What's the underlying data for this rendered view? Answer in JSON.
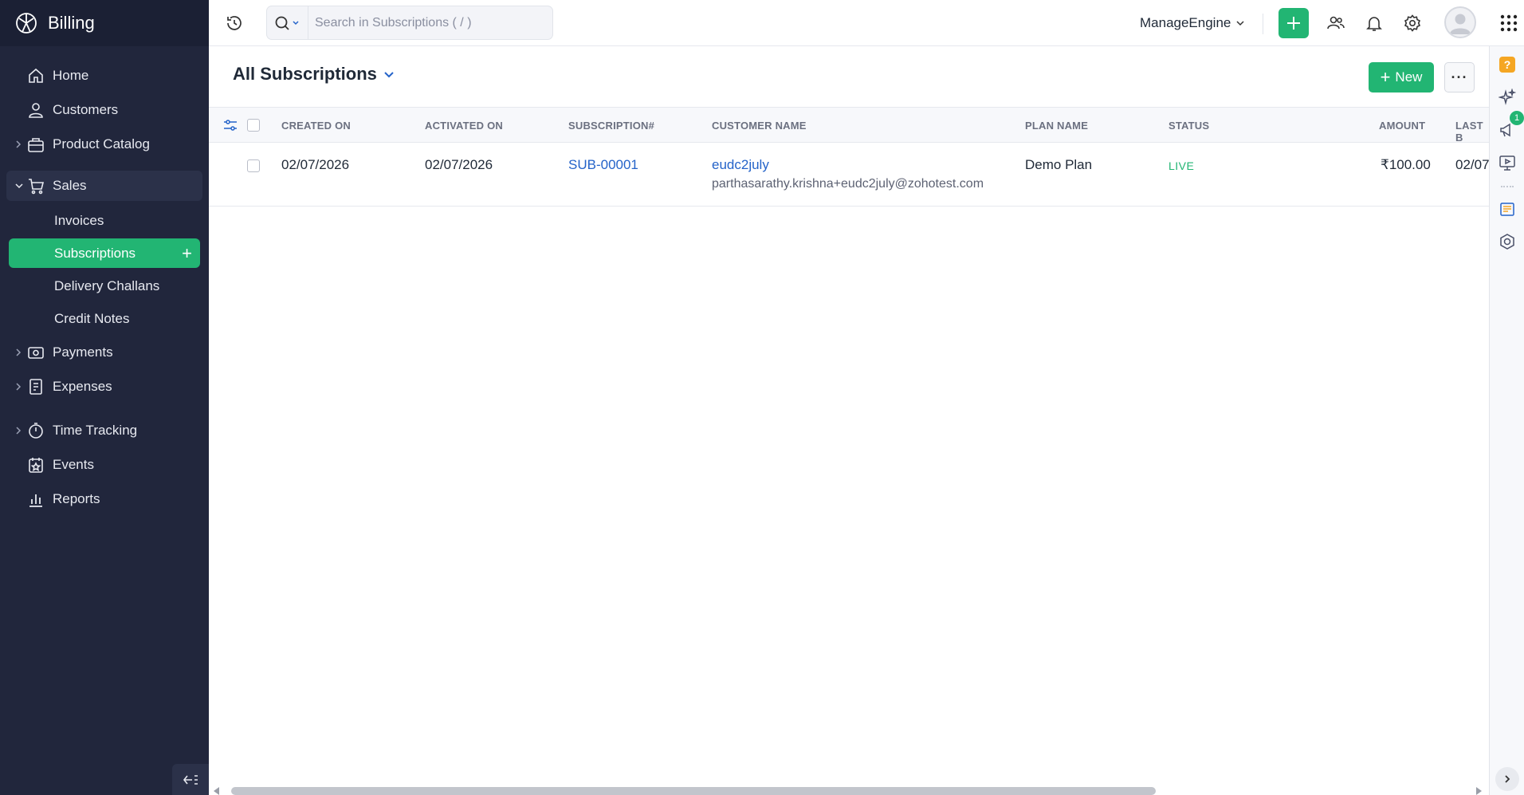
{
  "app": {
    "name": "Billing"
  },
  "sidebar": {
    "items": [
      {
        "label": "Home",
        "icon": "home-icon"
      },
      {
        "label": "Customers",
        "icon": "user-icon"
      },
      {
        "label": "Product Catalog",
        "icon": "bag-icon"
      },
      {
        "label": "Sales",
        "icon": "cart-icon"
      },
      {
        "label": "Payments",
        "icon": "payment-icon"
      },
      {
        "label": "Expenses",
        "icon": "receipt-icon"
      },
      {
        "label": "Time Tracking",
        "icon": "stopwatch-icon"
      },
      {
        "label": "Events",
        "icon": "event-icon"
      },
      {
        "label": "Reports",
        "icon": "reports-icon"
      }
    ],
    "sales_sub": [
      {
        "label": "Invoices"
      },
      {
        "label": "Subscriptions"
      },
      {
        "label": "Delivery Challans"
      },
      {
        "label": "Credit Notes"
      }
    ]
  },
  "topbar": {
    "search_placeholder": "Search in Subscriptions ( / )",
    "org_name": "ManageEngine"
  },
  "page": {
    "title": "All Subscriptions",
    "new_label": "New",
    "more_label": "···"
  },
  "table": {
    "columns": [
      "CREATED ON",
      "ACTIVATED ON",
      "SUBSCRIPTION#",
      "CUSTOMER NAME",
      "PLAN NAME",
      "STATUS",
      "AMOUNT",
      "LAST B"
    ],
    "rows": [
      {
        "created_on": "02/07/2026",
        "activated_on": "02/07/2026",
        "subscription_no": "SUB-00001",
        "customer_name": "eudc2july",
        "customer_email": "parthasarathy.krishna+eudc2july@zohotest.com",
        "plan_name": "Demo Plan",
        "status": "LIVE",
        "amount": "₹100.00",
        "last_billed": "02/07"
      }
    ]
  },
  "rightbar": {
    "notification_count": "1"
  },
  "colors": {
    "sidebar_bg": "#21263c",
    "accent_green": "#22b573",
    "link_blue": "#2463c9"
  }
}
